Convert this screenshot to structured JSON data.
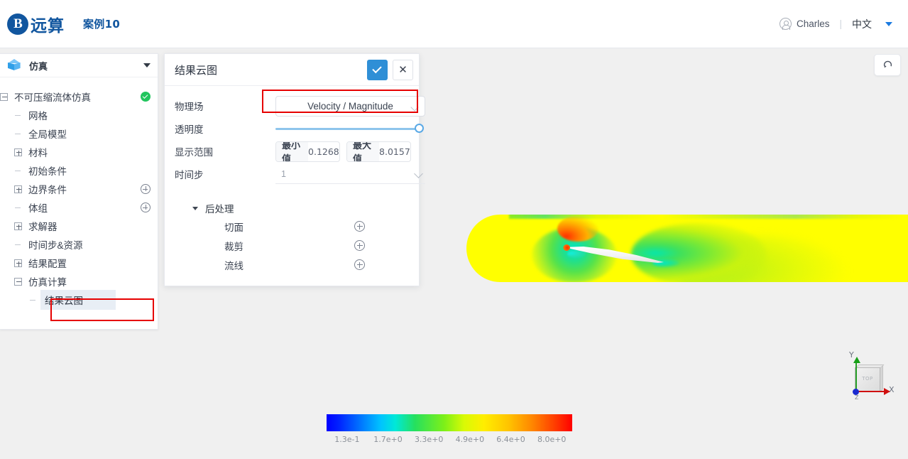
{
  "header": {
    "logo_glyph": "logo-mark-icon",
    "brand_name": "远算",
    "case_title": "案例10",
    "user_icon": "user-avatar-icon",
    "user_name": "Charles",
    "divider": "|",
    "language": "中文",
    "lang_caret": "caret-down-icon",
    "accent_color": "#11569f"
  },
  "tree_panel": {
    "icon": "cube-icon",
    "title": "仿真",
    "collapse_icon": "caret-down-icon",
    "nodes": [
      {
        "label": "不可压缩流体仿真",
        "level": 0,
        "toggle": "minus",
        "badge": "check-ok",
        "selected": false
      },
      {
        "label": "网格",
        "level": 1,
        "toggle": "dash",
        "badge": "none",
        "selected": false
      },
      {
        "label": "全局模型",
        "level": 1,
        "toggle": "dash",
        "badge": "none",
        "selected": false
      },
      {
        "label": "材料",
        "level": 1,
        "toggle": "plus",
        "badge": "none",
        "selected": false
      },
      {
        "label": "初始条件",
        "level": 1,
        "toggle": "dash",
        "badge": "none",
        "selected": false
      },
      {
        "label": "边界条件",
        "level": 1,
        "toggle": "plus",
        "badge": "add",
        "selected": false
      },
      {
        "label": "体组",
        "level": 1,
        "toggle": "dash",
        "badge": "add",
        "selected": false
      },
      {
        "label": "求解器",
        "level": 1,
        "toggle": "plus",
        "badge": "none",
        "selected": false
      },
      {
        "label": "时间步&资源",
        "level": 1,
        "toggle": "dash",
        "badge": "none",
        "selected": false
      },
      {
        "label": "结果配置",
        "level": 1,
        "toggle": "plus",
        "badge": "none",
        "selected": false
      },
      {
        "label": "仿真计算",
        "level": 1,
        "toggle": "minus",
        "badge": "none",
        "selected": false
      },
      {
        "label": "结果云图",
        "level": 2,
        "toggle": "dash",
        "badge": "none",
        "selected": true
      }
    ],
    "selection_highlight_color": "#e8eef5",
    "annotation_color": "#e60000"
  },
  "contour_panel": {
    "title": "结果云图",
    "confirm_icon": "check-icon",
    "close_icon": "close-icon",
    "confirm_color": "#2f8fd6",
    "fields": {
      "physical_field": {
        "label": "物理场",
        "value": "Velocity / Magnitude",
        "caret_icon": "chevron-down-icon",
        "highlighted": true
      },
      "opacity": {
        "label": "透明度",
        "value": 100,
        "min": 0,
        "max": 100,
        "fill_color": "#8ec5ec",
        "knob_color": "#5aa9e6"
      },
      "display_range": {
        "label": "显示范围",
        "min_tag": "最小值",
        "min_value": "0.1268",
        "max_tag": "最大值",
        "max_value": "8.0157"
      },
      "time_step": {
        "label": "时间步",
        "value": "1",
        "caret_icon": "chevron-down-icon"
      }
    },
    "post_processing": {
      "caret_icon": "caret-down-icon",
      "title": "后处理",
      "items": [
        {
          "label": "切面",
          "add_icon": "plus-circle-icon"
        },
        {
          "label": "裁剪",
          "add_icon": "plus-circle-icon"
        },
        {
          "label": "流线",
          "add_icon": "plus-circle-icon"
        }
      ]
    }
  },
  "viewport": {
    "reset_view_icon": "reset-rotate-icon",
    "background_color": "#f0f0f0",
    "axis_widget": {
      "x_label": "X",
      "y_label": "Y",
      "z_label": "Z",
      "cube_label": "TOP",
      "x_color": "#d01010",
      "y_color": "#17a017",
      "z_color": "#1a2ad0"
    }
  },
  "chart_data": {
    "type": "heatmap",
    "title": "Velocity / Magnitude",
    "colorbar_ticks": [
      "1.3e-1",
      "1.7e+0",
      "3.3e+0",
      "4.9e+0",
      "6.4e+0",
      "8.0e+0"
    ],
    "colorbar_values": [
      0.13,
      1.7,
      3.3,
      4.9,
      6.4,
      8.0
    ],
    "vmin": 0.1268,
    "vmax": 8.0157,
    "colormap": [
      "#0000ff",
      "#00c3ff",
      "#26e05e",
      "#d9fa05",
      "#ffc400",
      "#ff0000"
    ],
    "legend_position": "bottom",
    "grid": false,
    "xlabel": "",
    "ylabel": "",
    "annotations": [
      "airfoil immersed in uniform flow",
      "yellow freestream ~7 m/s",
      "green-cyan stagnation region at leading edge",
      "orange-red peak near suction peak",
      "green wake downstream of trailing edge"
    ]
  }
}
